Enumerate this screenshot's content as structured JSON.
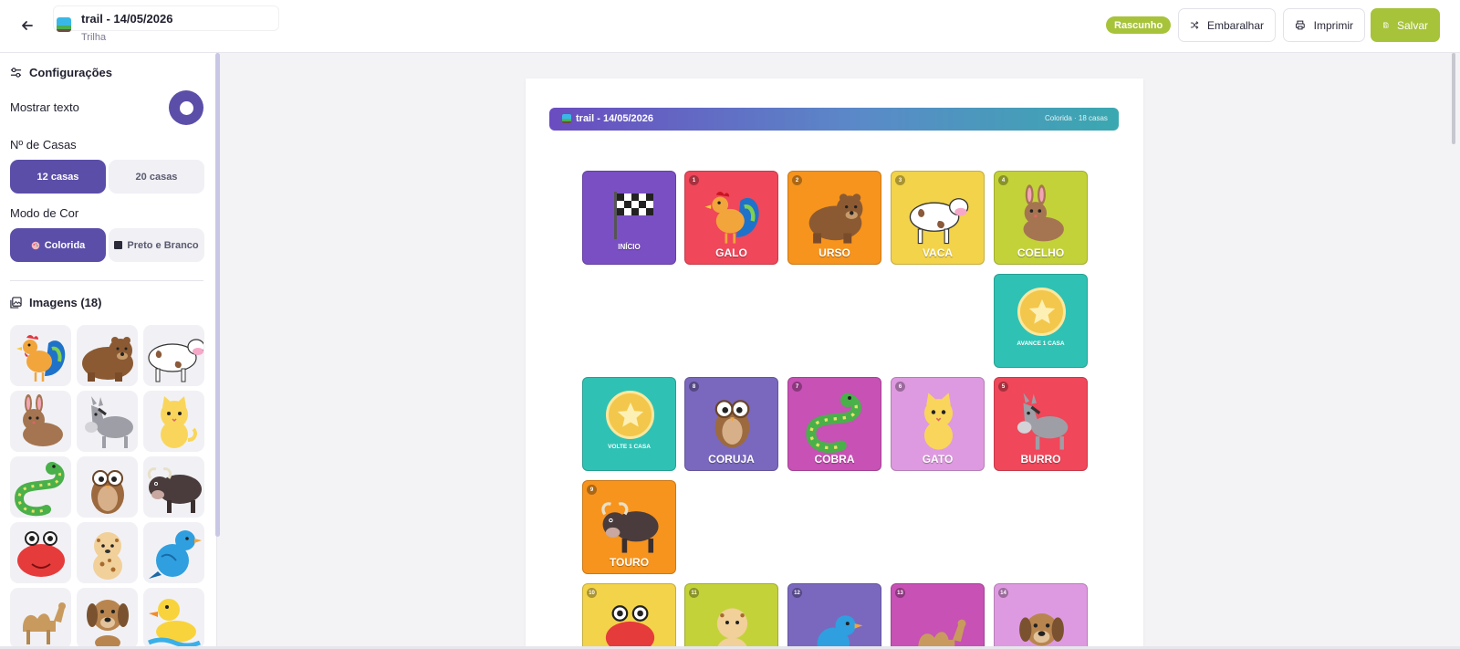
{
  "header": {
    "doc_title": "trail - 14/05/2026",
    "doc_subtitle": "Trilha",
    "status_badge": "Rascunho",
    "shuffle_label": "Embaralhar",
    "print_label": "Imprimir",
    "save_label": "Salvar"
  },
  "sidebar": {
    "settings_title": "Configurações",
    "show_text_label": "Mostrar texto",
    "show_text_enabled": true,
    "cells_label": "Nº de Casas",
    "cells_options": [
      "12 casas",
      "20 casas"
    ],
    "cells_selected": "12 casas",
    "color_mode_label": "Modo de Cor",
    "color_options": [
      "Colorida",
      "Preto e Branco"
    ],
    "color_selected": "Colorida",
    "images_title": "Imagens (18)",
    "images": [
      "galo",
      "urso",
      "vaca",
      "coelho",
      "burro",
      "gato",
      "cobra",
      "coruja",
      "touro",
      "caranguejo",
      "leopardo",
      "passaro",
      "camelo",
      "cachorro",
      "pato"
    ]
  },
  "board": {
    "banner_title": "trail - 14/05/2026",
    "banner_info": "Colorida · 18 casas",
    "tiles": [
      {
        "num": "",
        "label": "INÍCIO",
        "color": "#7a4fc4",
        "art": "flag"
      },
      {
        "num": "1",
        "label": "GALO",
        "color": "#f0475a",
        "art": "galo"
      },
      {
        "num": "2",
        "label": "URSO",
        "color": "#f7941d",
        "art": "urso"
      },
      {
        "num": "3",
        "label": "VACA",
        "color": "#f2d34a",
        "art": "vaca"
      },
      {
        "num": "4",
        "label": "COELHO",
        "color": "#c4d23a",
        "art": "coelho"
      },
      {
        "num": "",
        "label": "AVANCE 1 CASA",
        "color": "#2fc2b4",
        "art": "coin"
      },
      {
        "num": "5",
        "label": "BURRO",
        "color": "#f0475a",
        "art": "burro"
      },
      {
        "num": "6",
        "label": "GATO",
        "color": "#de9ae0",
        "art": "gato"
      },
      {
        "num": "7",
        "label": "COBRA",
        "color": "#c751b5",
        "art": "cobra"
      },
      {
        "num": "8",
        "label": "CORUJA",
        "color": "#7a68be",
        "art": "coruja"
      },
      {
        "num": "",
        "label": "VOLTE 1 CASA",
        "color": "#2fc2b4",
        "art": "coin"
      },
      {
        "num": "9",
        "label": "TOURO",
        "color": "#f7941d",
        "art": "touro"
      },
      {
        "num": "10",
        "label": "",
        "color": "#f2d34a",
        "art": "caranguejo"
      },
      {
        "num": "11",
        "label": "",
        "color": "#c4d23a",
        "art": "leopardo"
      },
      {
        "num": "12",
        "label": "",
        "color": "#7a68be",
        "art": "passaro"
      },
      {
        "num": "13",
        "label": "",
        "color": "#c751b5",
        "art": "camelo"
      },
      {
        "num": "14",
        "label": "",
        "color": "#de9ae0",
        "art": "cachorro"
      }
    ]
  }
}
